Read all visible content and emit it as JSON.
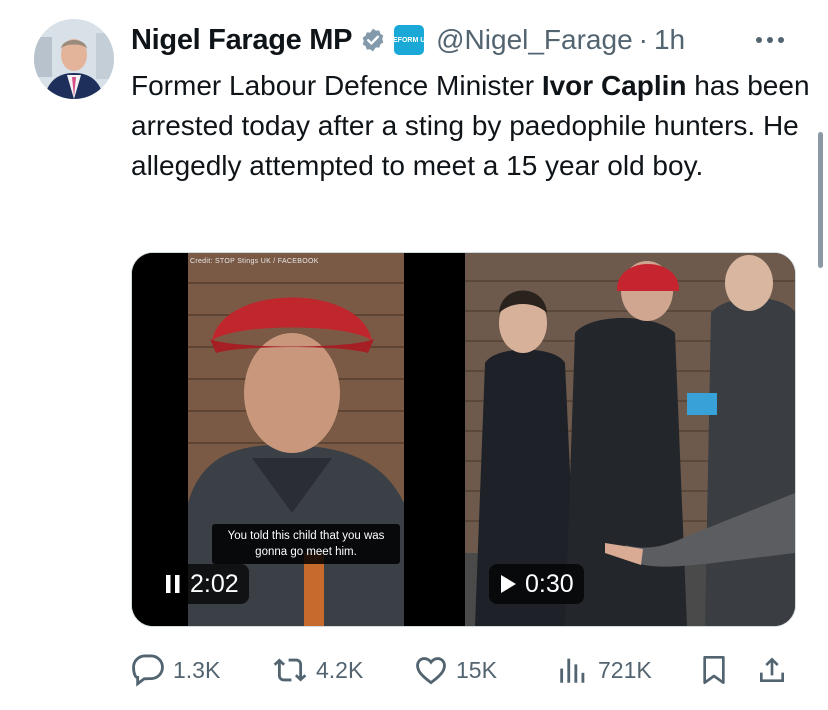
{
  "tweet": {
    "author_name": "Nigel Farage MP",
    "handle": "@Nigel_Farage",
    "separator": "·",
    "time": "1h",
    "affiliation_badge": "REFORM UK",
    "more_label": "···",
    "text_before": "Former Labour Defence Minister ",
    "text_bold": "Ivor Caplin",
    "text_after": " has been arrested today after a sting by paedophile hunters. He allegedly attempted to meet a 15 year old boy."
  },
  "media": {
    "video1": {
      "credit": "Credit: STOP Stings UK / FACEBOOK",
      "caption": "You told this child that you was gonna go meet him.",
      "duration": "2:02",
      "state": "pause-icon"
    },
    "video2": {
      "duration": "0:30",
      "state": "play-icon"
    }
  },
  "actions": {
    "replies": "1.3K",
    "reposts": "4.2K",
    "likes": "15K",
    "views": "721K"
  },
  "colors": {
    "text": "#0f1419",
    "secondary": "#536471",
    "verified": "#829aab",
    "affiliation": "#1aa9d6"
  }
}
